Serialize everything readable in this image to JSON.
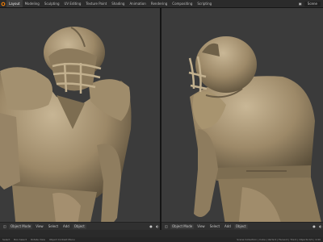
{
  "topbar": {
    "tabs": [
      "Layout",
      "Modeling",
      "Sculpting",
      "UV Editing",
      "Texture Paint",
      "Shading",
      "Animation",
      "Rendering",
      "Compositing",
      "Scripting"
    ],
    "active_tab": 0,
    "scene_label": "Scene"
  },
  "left_header": {
    "mode": "Object Mode",
    "menus": [
      "View",
      "Select",
      "Add",
      "Object"
    ]
  },
  "right_header": {
    "mode": "Object Mode",
    "menus": [
      "View",
      "Select",
      "Add",
      "Object"
    ]
  },
  "statusbar": {
    "items": [
      "Select",
      "Box Select",
      "Rotate View",
      "Object Context Menu"
    ],
    "stats": "Scene Collection | Cube | Verts:0 | Faces:0 | Tris:0 | Objects:0/1 | 2.90"
  },
  "colors": {
    "viewport_bg": "#3b3b3b",
    "clay": "#a89576",
    "accent": "#4772b3"
  }
}
